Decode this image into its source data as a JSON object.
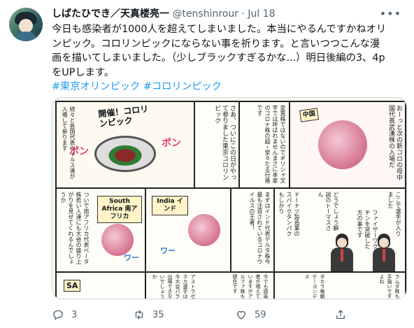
{
  "tweet": {
    "author_name": "しばたひでき／天真楼亮一",
    "handle": "@tenshinrour",
    "separator": "·",
    "date": "Jul 18",
    "more_icon": "more-horizontal-icon",
    "text_lines": [
      "今日も感染者が1000人を超えてしまいました。本当にやるんですかねオリ",
      "ンピック。コロリンピックにならない事を祈ります。と言いつつこんな漫",
      "画を描いてしまいました。（少しブラックすぎるかな...）明日後編の3、4p",
      "をUPします。"
    ],
    "hashtags": "#東京オリンピック #コロリンピック"
  },
  "manga": {
    "title": "開催！コロリンピック",
    "sfx_pon": "ポン",
    "sfx_wa": "ワー",
    "narration_1": "さあ、ついにこの日がやって参りました東京コロリンピック",
    "narration_2": "続々と各国代表ウイルス達が入場して参ります",
    "narration_3": "変異株ではないのでギリシャ文字では呼ばれませんまさに本家のコロナ株の超・堂々たる行進です",
    "narration_4": "おーっと次の新コロの母中国代表武漢株の入場だ",
    "narration_5": "まずはインド代表デルタ株今最も注目されているコロナウイルスの王者！",
    "narration_6": "ここで選手が入りました",
    "narration_7": "ついで南アフリカ代表ベータ株若い人達にも大会の盛り上がりを見せてくれるんでしょうか",
    "narration_8": "今でも感染者が増えていますがアルファ株も健在です",
    "narration_9": "どうでしょう解説のトーマスさん",
    "narration_10": "ファイザーワクチンを突破した方の事です",
    "narration_11": "アストラゼネカ選手は今大会パラ出場できないでしょうか",
    "narration_12": "ダカラ毎朝ゲーヨンデス",
    "narration_13": "ドーナツ製造業のスパイクタンパクもしかり",
    "narration_14": "ラムダ株も手強いですよね",
    "sign_south_africa": "South Africa 南アフリカ",
    "sign_india": "India インド",
    "sign_china": "中国",
    "sign_sa": "SA"
  },
  "actions": {
    "reply_icon": "reply-icon",
    "reply_count": "3",
    "retweet_icon": "retweet-icon",
    "retweet_count": "35",
    "like_icon": "heart-icon",
    "like_count": "59",
    "share_icon": "share-icon"
  },
  "colors": {
    "text": "#0f1419",
    "secondary": "#536471",
    "link": "#1d9bf0",
    "border": "#cfd9de"
  }
}
